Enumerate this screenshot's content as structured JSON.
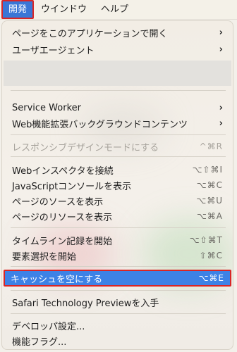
{
  "menubar": {
    "items": [
      "開発",
      "ウインドウ",
      "ヘルプ"
    ]
  },
  "menu": {
    "items": [
      {
        "label": "ページをこのアプリケーションで開く",
        "submenu": true
      },
      {
        "label": "ユーザエージェント",
        "submenu": true
      },
      {
        "label": "Service Worker",
        "submenu": true
      },
      {
        "label": "Web機能拡張バックグラウンドコンテンツ",
        "submenu": true
      },
      {
        "label": "レスポンシブデザインモードにする",
        "shortcut": "^⌘R",
        "disabled": true
      },
      {
        "label": "Webインスペクタを接続",
        "shortcut": "⌥⇧⌘I"
      },
      {
        "label": "JavaScriptコンソールを表示",
        "shortcut": "⌥⌘C"
      },
      {
        "label": "ページのソースを表示",
        "shortcut": "⌥⌘U"
      },
      {
        "label": "ページのリソースを表示",
        "shortcut": "⌥⌘A"
      },
      {
        "label": "タイムライン記録を開始",
        "shortcut": "⌥⇧⌘T"
      },
      {
        "label": "要素選択を開始",
        "shortcut": "⇧⌘C"
      },
      {
        "label": "キャッシュを空にする",
        "shortcut": "⌥⌘E",
        "highlighted": true
      },
      {
        "label": "Safari Technology Previewを入手"
      },
      {
        "label": "デベロッパ設定..."
      },
      {
        "label": "機能フラグ..."
      }
    ]
  },
  "chevron_glyph": "›",
  "colors": {
    "highlight": "#3d82e6",
    "annotation_border": "#d92626",
    "disabled_text": "#a7a39c"
  }
}
